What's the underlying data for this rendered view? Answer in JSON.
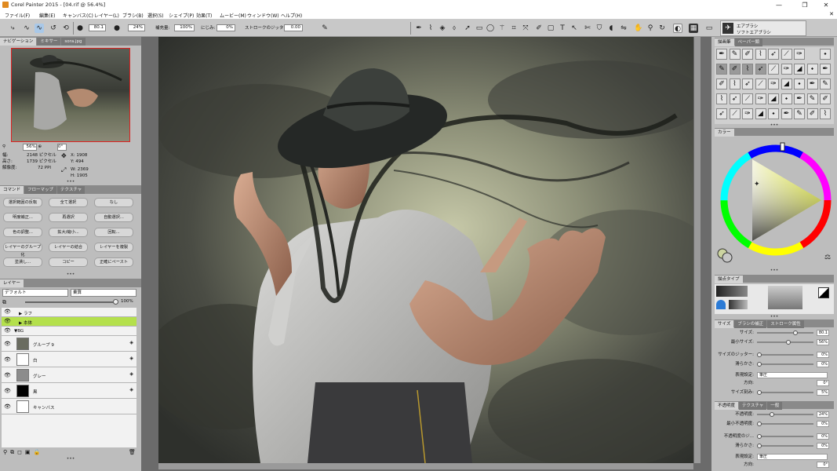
{
  "window": {
    "title": "Corel Painter 2015 - [04.rif @ 56.4%]",
    "controls": [
      "—",
      "❐",
      "✕"
    ]
  },
  "menu": {
    "items": [
      "ファイル(F)",
      "編集(E)",
      "キャンバス(C)",
      "レイヤー(L)",
      "ブラシ(B)",
      "選択(S)",
      "シェイプ(P)",
      "効果(T)",
      "ムービー(M)",
      "ウィンドウ(W)",
      "ヘルプ(H)"
    ],
    "close": "✕"
  },
  "propbar": {
    "size": "80.1",
    "opacity": "24%",
    "resat_label": "補充量:",
    "resat": "100%",
    "bleed_label": "にじみ:",
    "bleed": "0%",
    "jitter_label": "ストロークのジッター:",
    "jitter": "0.00"
  },
  "brush_selector": {
    "category": "エアブラシ",
    "variant": "ソフトエアブラシ"
  },
  "navigator": {
    "tabs": [
      "ナビゲーション",
      "ミキサー",
      "sora.jpg"
    ],
    "zoom": "56%",
    "rotation": "0°",
    "w_label": "幅:",
    "w": "2148 ピクセル",
    "h_label": "高さ:",
    "h": "1739 ピクセル",
    "res_label": "解像度:",
    "res": "72 PPI",
    "x": "X: 1908",
    "y": "Y: 494",
    "cw": "W: 2369",
    "ch": "H: 1905"
  },
  "command": {
    "tabs": [
      "コマンド",
      "フローマップ",
      "テクスチャ"
    ],
    "buttons": [
      "選択範囲の反転",
      "全て選択",
      "なし",
      "明度補正...",
      "再選択",
      "自動選択...",
      "色の調整...",
      "拡大/縮小...",
      "回転...",
      "レイヤーのグループ化",
      "レイヤーの結合",
      "レイヤーを複製",
      "塗潰し...",
      "コピー",
      "正確にペースト"
    ]
  },
  "layers": {
    "tab": "レイヤー",
    "preset": "デフォルト",
    "composite": "乗算",
    "opacity": "100%",
    "rows": [
      {
        "name": "ラフ",
        "type": "group"
      },
      {
        "name": "本体",
        "type": "group",
        "selected": true
      },
      {
        "name": "BG",
        "type": "group-open"
      },
      {
        "name": "グループ 9",
        "type": "layer"
      },
      {
        "name": "白",
        "type": "layer"
      },
      {
        "name": "グレー",
        "type": "layer"
      },
      {
        "name": "黒",
        "type": "layer"
      },
      {
        "name": "キャンバス",
        "type": "layer"
      }
    ]
  },
  "brushlib": {
    "tabs": [
      "描画筆",
      "ペーパー類"
    ]
  },
  "color": {
    "tab": "カラー"
  },
  "dabtype": {
    "tab": "描点タイプ"
  },
  "size_panel": {
    "tabs": [
      "サイズ",
      "ブラシの補正",
      "ストローク属性"
    ],
    "rows": [
      {
        "label": "サイズ:",
        "value": "80.1",
        "pct": 0.7
      },
      {
        "label": "最小サイズ:",
        "value": "56%",
        "pct": 0.56
      },
      {
        "label": "サイズのジッター:",
        "value": "0%",
        "pct": 0
      },
      {
        "label": "滑らかさ:",
        "value": "0%",
        "pct": 0
      }
    ],
    "expr_label": "表現設定:",
    "expr": "筆圧",
    "dir_label": "方向:",
    "dir": "0°",
    "step_label": "サイズ刻み:",
    "step": "5%"
  },
  "opacity_panel": {
    "tabs": [
      "不透明度",
      "テクスチャ",
      "一般"
    ],
    "rows": [
      {
        "label": "不透明度:",
        "value": "24%",
        "pct": 0.24
      },
      {
        "label": "最小不透明度:",
        "value": "0%",
        "pct": 0
      },
      {
        "label": "不透明度のジ...",
        "value": "0%",
        "pct": 0
      },
      {
        "label": "滑らかさ:",
        "value": "0%",
        "pct": 0
      }
    ],
    "expr_label": "表現設定:",
    "expr": "筆圧",
    "dir_label": "方向:",
    "dir": "0°"
  },
  "colors": {
    "accent": "#a8d84a",
    "selected_layer": "#b4e04c"
  }
}
